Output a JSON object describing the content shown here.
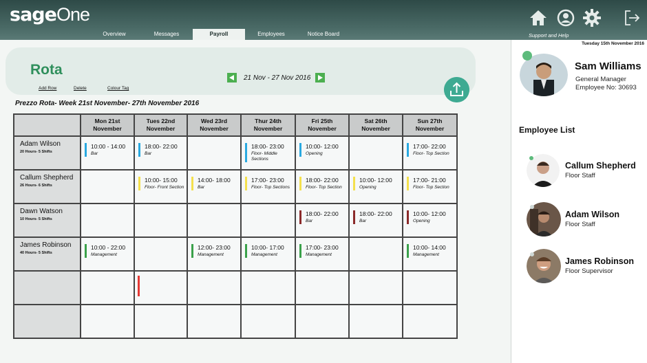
{
  "app": {
    "logo_bold": "sage",
    "logo_light": "One"
  },
  "nav": [
    {
      "label": "Overview",
      "active": false
    },
    {
      "label": "Messages",
      "active": false
    },
    {
      "label": "Payroll",
      "active": true
    },
    {
      "label": "Employees",
      "active": false
    },
    {
      "label": "Notice Board",
      "active": false
    }
  ],
  "header": {
    "support_label": "Support and Help",
    "icons": [
      "home-icon",
      "account-icon",
      "settings-icon",
      "logout-icon"
    ]
  },
  "rota": {
    "title": "Rota",
    "add_row": "Add Row",
    "delete": "Delete",
    "colour_tag": "Colour Tag",
    "week_range": "21 Nov - 27 Nov 2016",
    "subtitle": "Prezzo Rota- Week 21st November- 27th November 2016",
    "days": [
      {
        "l1": "Mon 21st",
        "l2": "November"
      },
      {
        "l1": "Tues 22nd",
        "l2": "November"
      },
      {
        "l1": "Wed 23rd",
        "l2": "November"
      },
      {
        "l1": "Thur 24th",
        "l2": "November"
      },
      {
        "l1": "Fri 25th",
        "l2": "November"
      },
      {
        "l1": "Sat 26th",
        "l2": "November"
      },
      {
        "l1": "Sun 27th",
        "l2": "November"
      }
    ],
    "rows": [
      {
        "name": "Adam Wilson",
        "hours": "20 Hours- 5 Shifts",
        "shifts": [
          {
            "time": "10:00 - 14:00",
            "role": "Bar",
            "color": "#29a9e0"
          },
          {
            "time": "18:00- 22:00",
            "role": "Bar",
            "color": "#29a9e0"
          },
          null,
          {
            "time": "18:00- 23:00",
            "role": "Floor- Middle Sections",
            "color": "#29a9e0"
          },
          {
            "time": "10:00- 12:00",
            "role": "Opening",
            "color": "#29a9e0"
          },
          null,
          {
            "time": "17:00- 22:00",
            "role": "Floor- Top Section",
            "color": "#29a9e0"
          }
        ]
      },
      {
        "name": "Callum Shepherd",
        "hours": "26 Hours- 6 Shifts",
        "shifts": [
          null,
          {
            "time": "10:00- 15:00",
            "role": "Floor- Front Section",
            "color": "#f4e04d"
          },
          {
            "time": "14:00- 18:00",
            "role": "Bar",
            "color": "#f4e04d"
          },
          {
            "time": "17:00- 23:00",
            "role": "Floor- Top Sections",
            "color": "#f4e04d"
          },
          {
            "time": "18:00- 22:00",
            "role": "Floor- Top Section",
            "color": "#f4e04d"
          },
          {
            "time": "10:00- 12:00",
            "role": "Opening",
            "color": "#f4e04d"
          },
          {
            "time": "17:00- 21:00",
            "role": "Floor- Top Section",
            "color": "#f4e04d"
          }
        ]
      },
      {
        "name": "Dawn Watson",
        "hours": "10 Hours- 5 Shifts",
        "shifts": [
          null,
          null,
          null,
          null,
          {
            "time": "18:00- 22:00",
            "role": "Bar",
            "color": "#8b2a2a"
          },
          {
            "time": "18:00- 22:00",
            "role": "Bar",
            "color": "#8b2a2a"
          },
          {
            "time": "10:00- 12:00",
            "role": "Opening",
            "color": "#8b2a2a"
          }
        ]
      },
      {
        "name": "James Robinson",
        "hours": "40 Hours- 5 Shifts",
        "shifts": [
          {
            "time": "10:00 - 22:00",
            "role": "Management",
            "color": "#3aa14a"
          },
          null,
          {
            "time": "12:00- 23:00",
            "role": "Management",
            "color": "#3aa14a"
          },
          {
            "time": "10:00- 17:00",
            "role": "Management",
            "color": "#3aa14a"
          },
          {
            "time": "17:00- 23:00",
            "role": "Management",
            "color": "#3aa14a"
          },
          null,
          {
            "time": "10:00- 14:00",
            "role": "Management",
            "color": "#3aa14a"
          }
        ]
      },
      {
        "name": "",
        "hours": "",
        "shifts": [
          null,
          null,
          null,
          null,
          null,
          null,
          null
        ]
      },
      {
        "name": "",
        "hours": "",
        "shifts": [
          null,
          null,
          null,
          null,
          null,
          null,
          null
        ]
      }
    ]
  },
  "profile": {
    "date": "Tuesday 15th November 2016",
    "name": "Sam Williams",
    "role": "General Manager",
    "employee_no": "Employee No: 30693"
  },
  "employee_list": {
    "title": "Employee List",
    "items": [
      {
        "name": "Callum Shepherd",
        "role": "Floor Staff"
      },
      {
        "name": "Adam Wilson",
        "role": "Floor Staff"
      },
      {
        "name": "James Robinson",
        "role": "Floor Supervisor"
      }
    ]
  },
  "colors": {
    "accent_green": "#2f8f5c",
    "export_button": "#3eaa92",
    "header": "#3d5c58"
  }
}
